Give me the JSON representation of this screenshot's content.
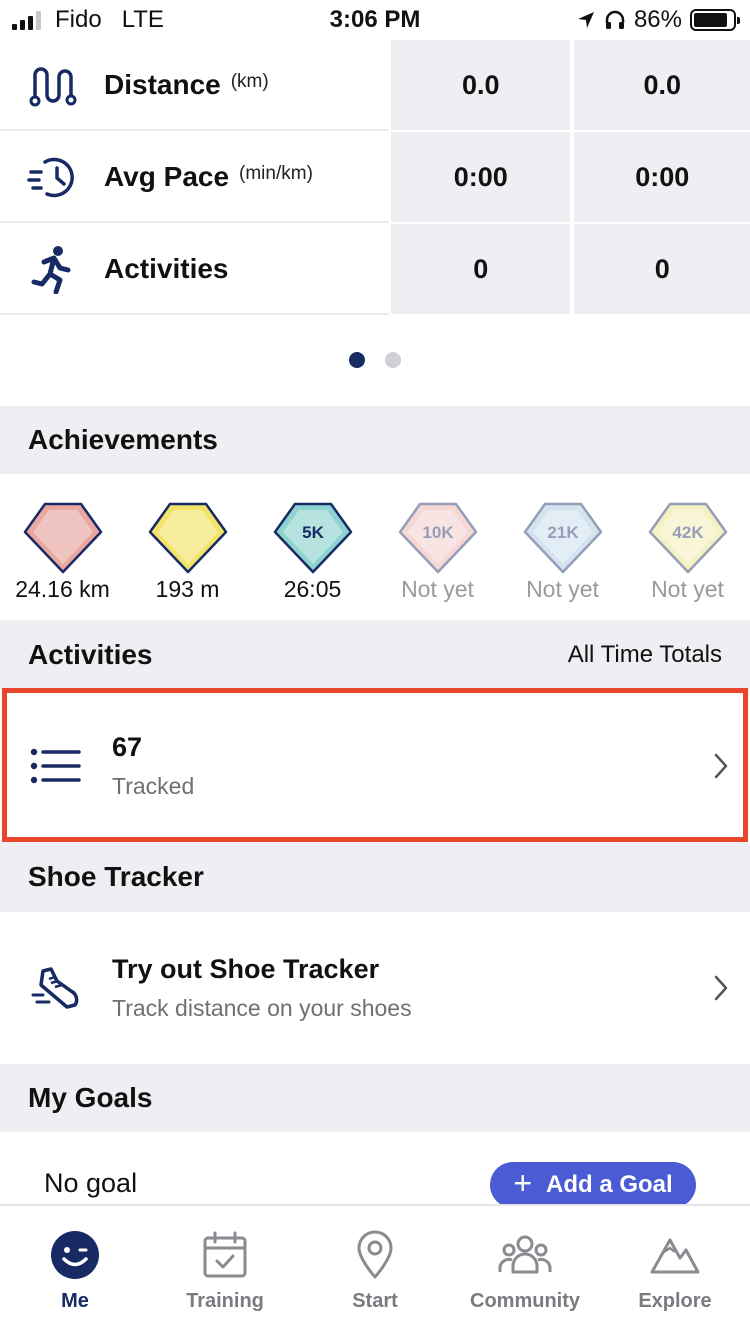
{
  "status_bar": {
    "carrier": "Fido",
    "network": "LTE",
    "time": "3:06 PM",
    "battery": "86%",
    "battery_level": 0.86
  },
  "stats": [
    {
      "name": "Distance",
      "unit": "(km)",
      "icon": "route-icon",
      "col1": "0.0",
      "col2": "0.0"
    },
    {
      "name": "Avg Pace",
      "unit": "(min/km)",
      "icon": "pace-clock-icon",
      "col1": "0:00",
      "col2": "0:00"
    },
    {
      "name": "Activities",
      "unit": "",
      "icon": "runner-icon",
      "col1": "0",
      "col2": "0"
    }
  ],
  "pager": {
    "pages": 2,
    "active": 1
  },
  "achievements": {
    "title": "Achievements",
    "badges": [
      {
        "label": "24.16 km",
        "locked": false,
        "badge_text": "",
        "color": "#e9a7a0"
      },
      {
        "label": "193 m",
        "locked": false,
        "badge_text": "",
        "color": "#f2e36a"
      },
      {
        "label": "26:05",
        "locked": false,
        "badge_text": "5K",
        "color": "#8fd3d0"
      },
      {
        "label": "Not yet",
        "locked": true,
        "badge_text": "10K",
        "color": "#e9a7a0"
      },
      {
        "label": "Not yet",
        "locked": true,
        "badge_text": "21K",
        "color": "#9fc4e0"
      },
      {
        "label": "Not yet",
        "locked": true,
        "badge_text": "42K",
        "color": "#e8e27a"
      }
    ]
  },
  "activities": {
    "title": "Activities",
    "subtitle": "All Time Totals",
    "count": "67",
    "count_label": "Tracked"
  },
  "shoe_tracker": {
    "title": "Shoe Tracker",
    "primary": "Try out Shoe Tracker",
    "secondary": "Track distance on your shoes"
  },
  "goals": {
    "title": "My Goals",
    "status": "No goal",
    "add_button": "Add a Goal"
  },
  "tabs": [
    {
      "label": "Me",
      "icon": "smiley-icon",
      "active": true
    },
    {
      "label": "Training",
      "icon": "calendar-icon",
      "active": false
    },
    {
      "label": "Start",
      "icon": "location-pin-icon",
      "active": false
    },
    {
      "label": "Community",
      "icon": "people-icon",
      "active": false
    },
    {
      "label": "Explore",
      "icon": "mountains-icon",
      "active": false
    }
  ],
  "colors": {
    "navy": "#172a63",
    "accent": "#4b5bd3",
    "highlight": "#e8452c",
    "section_bg": "#efeff3"
  }
}
